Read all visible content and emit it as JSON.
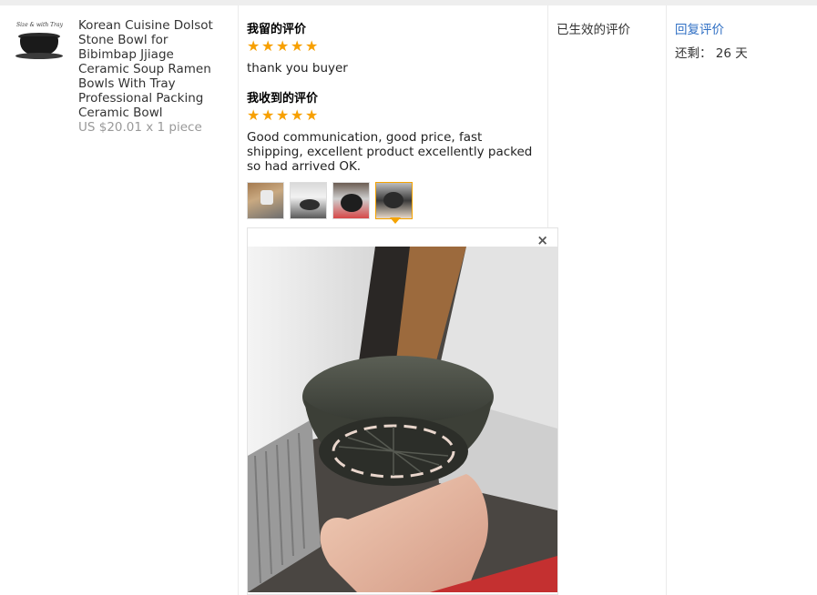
{
  "product": {
    "thumb_caption": "Size & with Tray",
    "title": "Korean Cuisine Dolsot Stone Bowl for Bibimbap Jjiage Ceramic Soup Ramen Bowls With Tray Professional Packing Ceramic Bowl",
    "price": "US $20.01 x 1 piece"
  },
  "left_review": {
    "heading": "我留的评价",
    "rating": 5,
    "text": "thank you buyer"
  },
  "received_review": {
    "heading": "我收到的评价",
    "rating": 5,
    "text": "Good communication, good price, fast shipping, excellent product excellently packed so had arrived OK.",
    "photos": [
      "photo-1",
      "photo-2",
      "photo-3",
      "photo-4"
    ],
    "active_photo": 4
  },
  "viewer": {
    "close_label": "×"
  },
  "status": {
    "label": "已生效的评价"
  },
  "actions": {
    "reply_label": "回复评价",
    "remaining_label": "还剩：",
    "remaining_value": "26 天"
  },
  "colors": {
    "star": "#f7a000",
    "link": "#3170c4",
    "active_border": "#f5a300",
    "price": "#999999"
  }
}
